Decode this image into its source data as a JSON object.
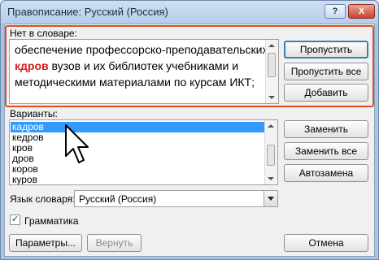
{
  "window": {
    "title": "Правописание: Русский (Россия)",
    "help_glyph": "?",
    "close_glyph": "X"
  },
  "not_in_dictionary": {
    "label": "Нет в словаре:",
    "lines": [
      {
        "text": "обеспечение профессорско-преподавательских"
      },
      {
        "error_word": "кдров",
        "rest": " вузов и их библиотек учебниками и"
      },
      {
        "text": "методическими материалами по курсам ИКТ;"
      }
    ]
  },
  "right_buttons_top": {
    "skip": "Пропустить",
    "skip_all": "Пропустить все",
    "add": "Добавить"
  },
  "suggestions": {
    "label": "Варианты:",
    "items": [
      "кадров",
      "кедров",
      "кров",
      "дров",
      "коров",
      "куров"
    ],
    "selected_index": 0
  },
  "right_buttons_mid": {
    "change": "Заменить",
    "change_all": "Заменить все",
    "autocorrect": "Автозамена"
  },
  "dictionary_language": {
    "label": "Язык словаря:",
    "value": "Русский (Россия)"
  },
  "grammar": {
    "label": "Грамматика",
    "checked": true,
    "check_glyph": "✓"
  },
  "bottom": {
    "options": "Параметры...",
    "undo": "Вернуть",
    "cancel": "Отмена"
  },
  "colors": {
    "error_word": "#d11b1b",
    "highlight_border": "#e0501f",
    "selection": "#3399ff"
  }
}
